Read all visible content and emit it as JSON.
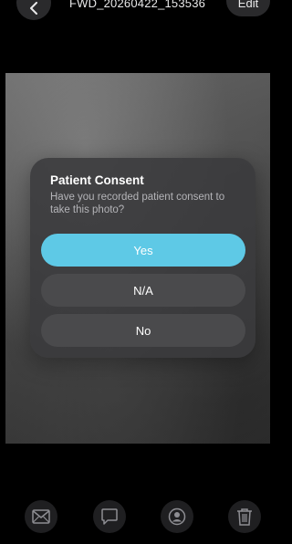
{
  "header": {
    "title": "FWD_20260422_153536",
    "edit_label": "Edit",
    "back_icon": "chevron-left-icon"
  },
  "dialog": {
    "title": "Patient Consent",
    "message": "Have you recorded patient consent to take this photo?",
    "options": [
      {
        "label": "Yes",
        "style": "primary"
      },
      {
        "label": "N/A",
        "style": "secondary"
      },
      {
        "label": "No",
        "style": "secondary"
      }
    ]
  },
  "toolbar": {
    "icons": [
      "mail-icon",
      "comment-icon",
      "person-icon",
      "trash-icon"
    ]
  },
  "colors": {
    "background": "#000000",
    "dialog_bg": "#3a3a3c",
    "primary_button": "#5ec9e6",
    "secondary_button": "#4a4a4c",
    "icon_gray": "#8e8e93"
  }
}
